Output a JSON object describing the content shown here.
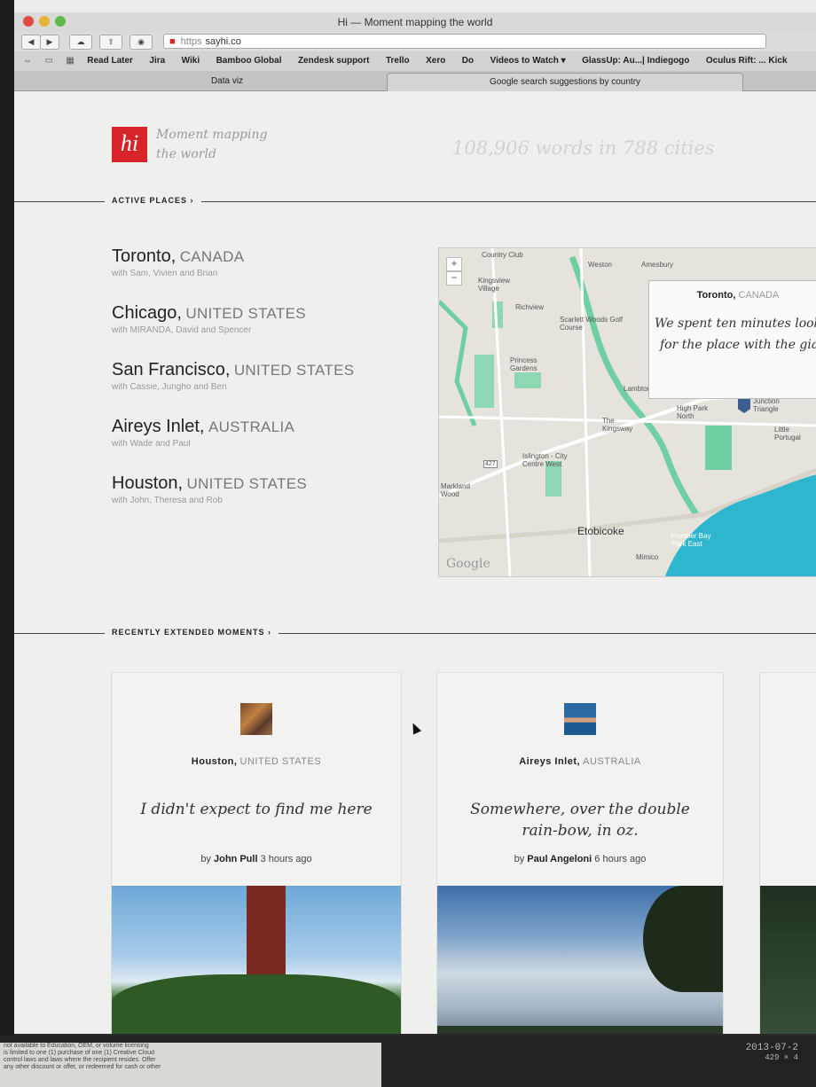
{
  "browser": {
    "window_title": "Hi — Moment mapping the world",
    "url_scheme": "https",
    "url_host": "sayhi.co",
    "bookmarks": [
      "Read Later",
      "Jira",
      "Wiki",
      "Bamboo Global",
      "Zendesk support",
      "Trello",
      "Xero",
      "Do",
      "Videos to Watch ▾",
      "GlassUp: Au...| Indiegogo",
      "Oculus Rift: ... Kick"
    ],
    "tabs": [
      "Data viz",
      "Google search suggestions by country"
    ]
  },
  "header": {
    "logo_text": "hi",
    "tagline_line1": "Moment mapping",
    "tagline_line2": "the world",
    "stats": "108,906 words in 788 cities"
  },
  "sections": {
    "active_places": "ACTIVE PLACES  ›",
    "recent_moments": "RECENTLY EXTENDED MOMENTS  ›"
  },
  "places": [
    {
      "city": "Toronto,",
      "country": "CANADA",
      "with": "with Sam, Vivien and Brian"
    },
    {
      "city": "Chicago,",
      "country": "UNITED STATES",
      "with": "with MIRANDA, David and Spencer"
    },
    {
      "city": "San Francisco,",
      "country": "UNITED STATES",
      "with": "with Cassie, Jungho and Ben"
    },
    {
      "city": "Aireys Inlet,",
      "country": "AUSTRALIA",
      "with": "with Wade and Paul"
    },
    {
      "city": "Houston,",
      "country": "UNITED STATES",
      "with": "with John, Theresa and Rob"
    }
  ],
  "map": {
    "zoom_in": "+",
    "zoom_out": "−",
    "labels": {
      "country_club": "Country Club",
      "weston": "Weston",
      "amesbury": "Amesbury",
      "kingsview": "Kingsview Village",
      "richview": "Richview",
      "scarlett": "Scarlett Woods Golf Course",
      "princess": "Princess Gardens",
      "lambton": "Lambton",
      "high_park": "High Park North",
      "junction": "Junction Triangle",
      "little_portugal": "Little Portugal",
      "kingsway": "The Kingsway",
      "islington": "Islington - City Centre West",
      "markland": "Markland Wood",
      "etobicoke": "Etobicoke",
      "humber": "Humber Bay Park East",
      "mimico": "Mimico",
      "hwy": "427"
    },
    "attribution": "Google",
    "info_place": "Toronto,",
    "info_country": "CANADA",
    "info_quote_1": "We spent ten minutes look",
    "info_quote_2": "for the place with the gia",
    "colors": {
      "water": "#2fb6cf",
      "park": "#6fcfa3",
      "land": "#e6e3dc"
    }
  },
  "moments": [
    {
      "place": "Houston,",
      "country": "UNITED STATES",
      "quote": "I didn't expect to find me here",
      "by": "by",
      "author": "John Pull",
      "time": "3 hours ago"
    },
    {
      "place": "Aireys Inlet,",
      "country": "AUSTRALIA",
      "quote": "Somewhere, over the double rain-bow, in oz.",
      "by": "by",
      "author": "Paul Angeloni",
      "time": "6 hours ago"
    }
  ],
  "desk": {
    "paper_lines": [
      "not available to Education, OEM, or volume licensing",
      "is limited to one (1) purchase of one (1) Creative Cloud",
      "control laws and laws where the recipient resides. Offer",
      "any other discount or offer, or redeemed for cash or other"
    ],
    "timestamp": "2013-07-2",
    "dims": "429 × 4"
  },
  "brand_color": "#d8232a"
}
